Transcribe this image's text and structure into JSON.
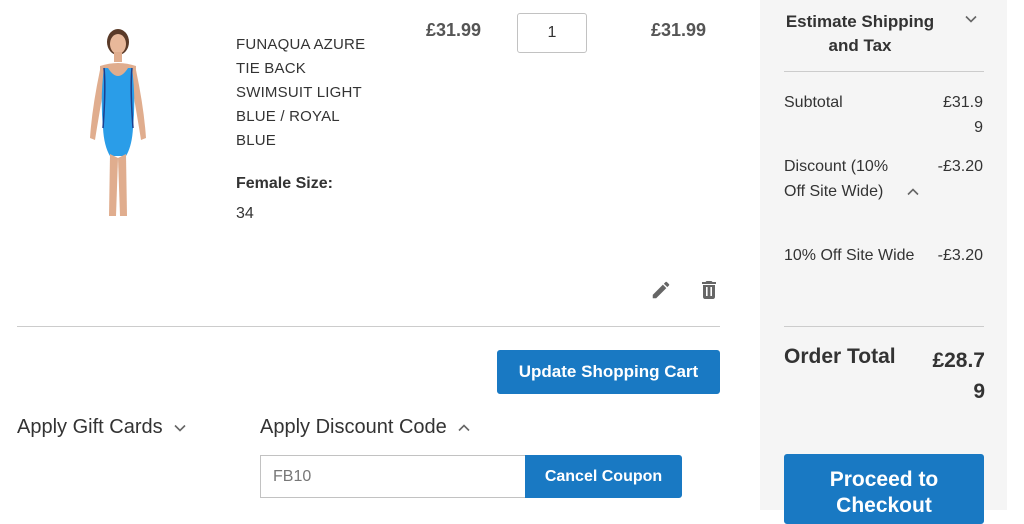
{
  "item": {
    "name": "FUNAQUA AZURE TIE BACK SWIMSUIT LIGHT BLUE / ROYAL BLUE",
    "option_label": "Female Size:",
    "option_value": "34",
    "price": "£31.99",
    "qty": "1",
    "subtotal": "£31.99"
  },
  "icons": {
    "edit": "pencil-icon",
    "delete": "trash-icon"
  },
  "actions": {
    "update_cart": "Update Shopping Cart"
  },
  "gift_cards": {
    "label": "Apply Gift Cards"
  },
  "discount": {
    "label": "Apply Discount Code",
    "code_value": "FB10",
    "cancel_label": "Cancel Coupon"
  },
  "summary": {
    "title": "Estimate Shipping and Tax",
    "subtotal_label": "Subtotal",
    "subtotal_amount": "£31.99",
    "discount_label": "Discount (10% Off Site Wide)",
    "discount_amount": "-£3.20",
    "discount_detail_label": "10% Off Site Wide",
    "discount_detail_amount": "-£3.20",
    "total_label": "Order Total",
    "total_amount": "£28.79",
    "checkout_label": "Proceed to Checkout"
  },
  "colors": {
    "primary": "#1979c3",
    "swimsuit": "#2a9de8",
    "sidebar_bg": "#f5f5f5"
  }
}
